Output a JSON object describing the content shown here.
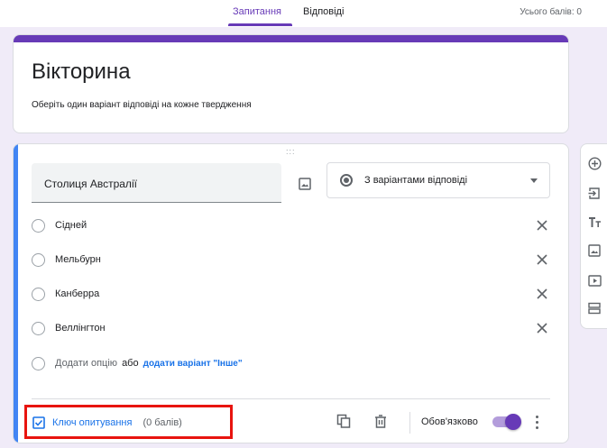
{
  "tabs": [
    {
      "label": "Запитання",
      "active": true
    },
    {
      "label": "Відповіді",
      "active": false
    }
  ],
  "total_points": "Усього балів: 0",
  "form": {
    "title": "Вікторина",
    "description": "Оберіть один варіант відповіді на кожне твердження"
  },
  "question": {
    "drag_handle": ":::",
    "title": "Столиця Австралії",
    "type": "З варіантами відповіді",
    "options": [
      "Сідней",
      "Мельбурн",
      "Канберра",
      "Веллінгтон"
    ],
    "add_option": "Додати опцію",
    "or": "або",
    "add_other": "додати варіант \"Інше\""
  },
  "footer": {
    "answer_key": "Ключ опитування",
    "points": "(0 балів)",
    "required_label": "Обов'язково",
    "required": true
  },
  "tools": [
    "add-question-icon",
    "import-questions-icon",
    "add-title-icon",
    "add-image-icon",
    "add-video-icon",
    "add-section-icon"
  ],
  "colors": {
    "accent": "#673ab7",
    "background": "#f0ebf8",
    "active_card": "#4285f4",
    "link": "#1a73e8",
    "highlight": "#e8140f"
  }
}
